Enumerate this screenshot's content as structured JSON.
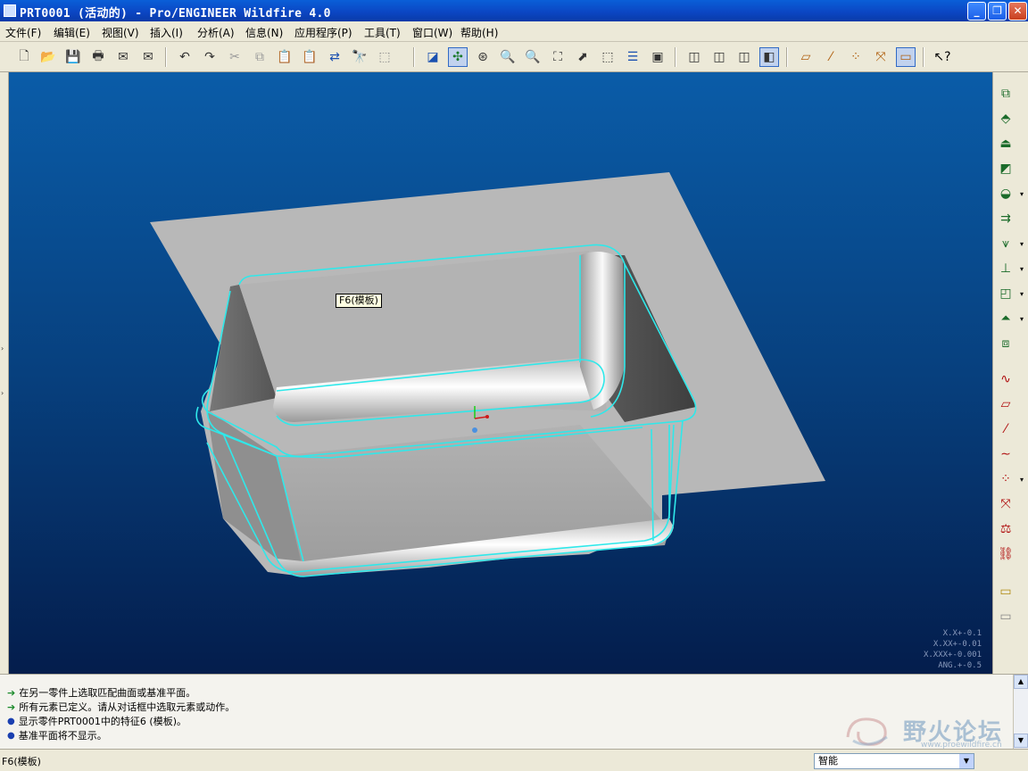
{
  "window": {
    "title": "PRT0001 (活动的) - Pro/ENGINEER Wildfire 4.0",
    "minimize": "_",
    "restore": "❐",
    "close": "✕"
  },
  "menu": [
    "文件(F)",
    "编辑(E)",
    "视图(V)",
    "插入(I)",
    "分析(A)",
    "信息(N)",
    "应用程序(P)",
    "工具(T)",
    "窗口(W)",
    "帮助(H)"
  ],
  "toolbar": {
    "icons": [
      "new-icon",
      "open-icon",
      "save-icon",
      "print-icon",
      "send-mail-icon",
      "send-mail-attach-icon",
      "undo-icon",
      "redo-icon",
      "cut-icon",
      "copy-icon",
      "paste-icon",
      "paste-special-icon",
      "regenerate-icon",
      "find-icon",
      "select-box-icon",
      "repaint-icon",
      "spin-center-icon",
      "orient-mode-icon",
      "zoom-in-icon",
      "zoom-out-icon",
      "refit-icon",
      "reorient-icon",
      "saved-views-icon",
      "layers-icon",
      "view-manager-icon",
      "wireframe-icon",
      "hidden-line-icon",
      "no-hidden-icon",
      "shading-icon",
      "datum-planes-icon",
      "datum-axes-icon",
      "datum-points-icon",
      "csys-icon",
      "annotations-icon",
      "context-help-icon"
    ]
  },
  "right_toolbar": {
    "icons": [
      "hole-icon",
      "shell-icon",
      "rib-icon",
      "draft-icon",
      "round-icon",
      "chamfer-icon",
      "pattern-icon",
      "mirror-icon",
      "merge-icon",
      "trim-icon",
      "extend-icon",
      "offset-icon",
      "sketch-tool-icon",
      "datum-plane-tool-icon",
      "datum-axis-tool-icon",
      "datum-curve-tool-icon",
      "datum-point-tool-icon",
      "csys-tool-icon",
      "analysis-tool-icon",
      "coordinate-tool-icon",
      "insert-udf-icon",
      "copy-geometry-icon"
    ]
  },
  "viewport": {
    "tooltip": "F6(模板)",
    "tolerance": [
      "X.X+-0.1",
      "X.XX+-0.01",
      "X.XXX+-0.001",
      "ANG.+-0.5"
    ]
  },
  "messages": [
    {
      "type": "prompt",
      "text": "在另一零件上选取匹配曲面或基准平面。"
    },
    {
      "type": "prompt",
      "text": "所有元素已定义。请从对话框中选取元素或动作。"
    },
    {
      "type": "info",
      "text": "显示零件PRT0001中的特征6 (模板)。"
    },
    {
      "type": "info",
      "text": "基准平面将不显示。"
    }
  ],
  "logo": {
    "text": "野火论坛",
    "url": "www.proewildfire.cn"
  },
  "status": {
    "text": "F6(模板)",
    "filter_value": "智能"
  },
  "colors": {
    "accent": "#00ffff",
    "viewport_top": "#0a5ca8",
    "viewport_bottom": "#041d4c"
  }
}
